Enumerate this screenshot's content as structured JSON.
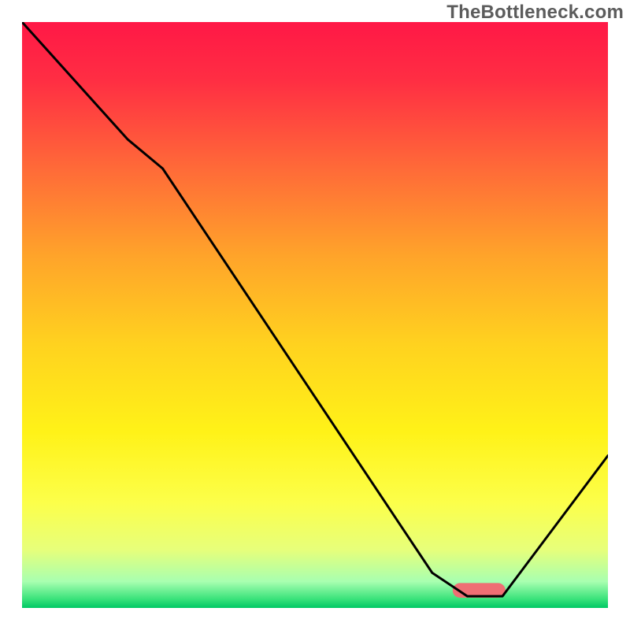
{
  "watermark": "TheBottleneck.com",
  "chart_data": {
    "type": "line",
    "title": "",
    "xlabel": "",
    "ylabel": "",
    "xlim": [
      0,
      100
    ],
    "ylim": [
      0,
      100
    ],
    "grid": false,
    "background": {
      "type": "vertical-gradient",
      "stops": [
        {
          "offset": 0.0,
          "color": "#ff1846"
        },
        {
          "offset": 0.1,
          "color": "#ff2e43"
        },
        {
          "offset": 0.25,
          "color": "#ff6a38"
        },
        {
          "offset": 0.4,
          "color": "#ffa42a"
        },
        {
          "offset": 0.55,
          "color": "#ffd21f"
        },
        {
          "offset": 0.7,
          "color": "#fff218"
        },
        {
          "offset": 0.82,
          "color": "#fcff4a"
        },
        {
          "offset": 0.9,
          "color": "#e7ff7a"
        },
        {
          "offset": 0.955,
          "color": "#a8ffb0"
        },
        {
          "offset": 0.985,
          "color": "#39e27a"
        },
        {
          "offset": 1.0,
          "color": "#00c864"
        }
      ]
    },
    "series": [
      {
        "name": "curve",
        "color": "#000000",
        "strokeWidth": 3,
        "x": [
          0,
          18,
          24,
          70,
          76,
          82,
          100
        ],
        "values": [
          100,
          80,
          75,
          6,
          2,
          2,
          26
        ]
      }
    ],
    "markers": [
      {
        "name": "target-band",
        "shape": "rounded-rect",
        "color": "#ef6f74",
        "x_center": 78,
        "y": 3,
        "width_x": 9,
        "height_y": 2.5
      }
    ]
  }
}
